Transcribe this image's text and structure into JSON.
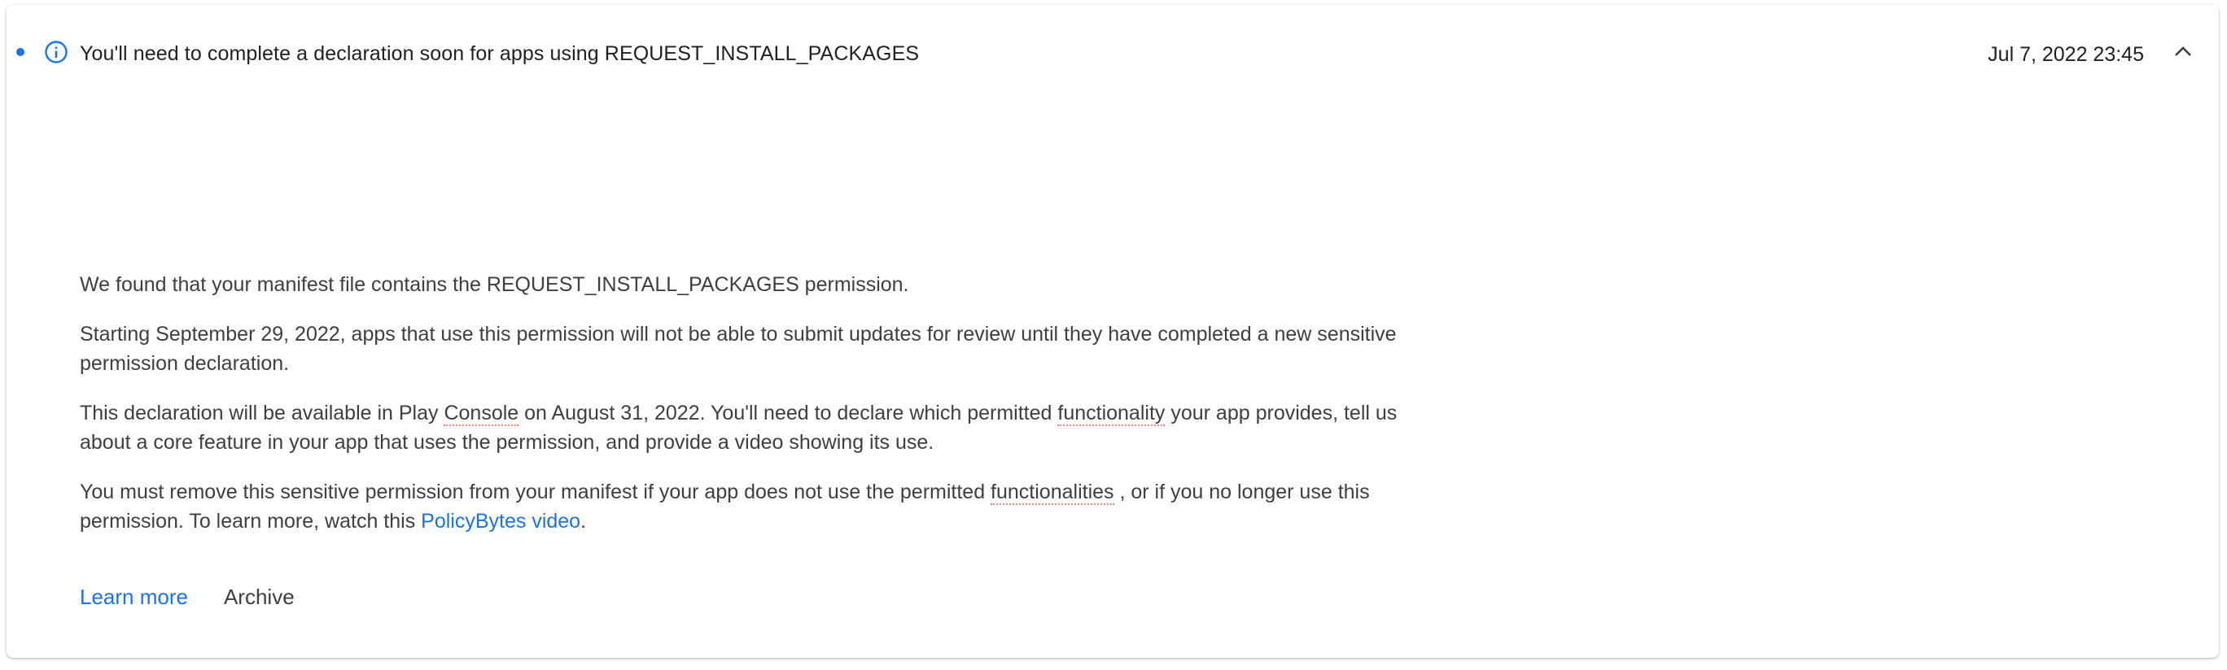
{
  "notification": {
    "title": "You'll need to complete a declaration soon for apps using REQUEST_INSTALL_PACKAGES",
    "timestamp": "Jul 7, 2022 23:45",
    "status_icon": "info-icon",
    "collapse_icon": "chevron-up-icon",
    "unread": true,
    "body": {
      "p1": "We found that your manifest file contains the REQUEST_INSTALL_PACKAGES permission.",
      "p2": "Starting September 29, 2022, apps that use this permission will not be able to submit updates for review until they have completed a new sensitive permission declaration.",
      "p3_a": "This declaration will be available in Play ",
      "p3_console": "Console",
      "p3_b": " on August 31, 2022. You'll need to declare which permitted ",
      "p3_functionality": "functionality",
      "p3_c": " your app provides, tell us about a core feature in your app that uses the permission, and provide a video showing its use.",
      "p4_a": "You must remove this sensitive permission from your manifest if your app does not use the permitted ",
      "p4_functionalities": "functionalities",
      "p4_b": " , or if you no longer use this permission. To learn more, watch this ",
      "p4_link": "PolicyBytes video",
      "p4_c": "."
    },
    "actions": {
      "learn_more": "Learn more",
      "archive": "Archive"
    }
  },
  "colors": {
    "accent": "#1a73e8",
    "text_primary": "#202124",
    "text_secondary": "#3c4043",
    "spellcheck_underline": "#f28b82"
  }
}
